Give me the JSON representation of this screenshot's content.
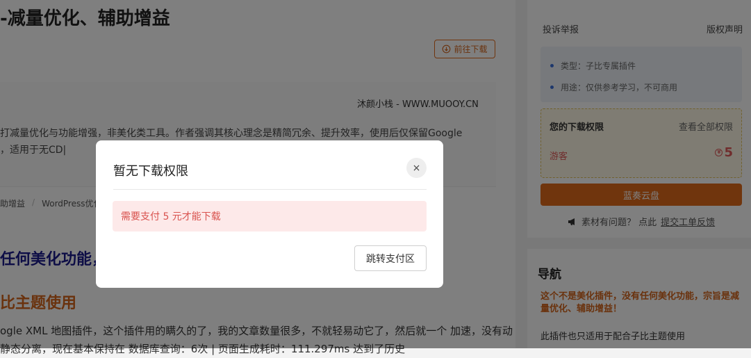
{
  "article": {
    "title": "-减量优化、辅助增益",
    "download_label": "前往下载",
    "source": "沐颜小栈 - WWW.MUOOY.CN",
    "excerpt": "打减量优化与功能增强，非美化类工具。作者强调其核心理念是精简冗余、提升效率，使用后仅保留Google ，适用于无CD|",
    "tags": [
      "助增益",
      "WordPress优化"
    ],
    "heading_blue": "任何美化功能，",
    "heading_orange": "比主题使用",
    "body": "ogle XML 地图插件，这个插件用的瞒久的了，我的文章数量很多，不就轻易动它了，然后就一个 加速，没有动静态分离，现在基本保持在 数据库查询：6次 | 页面生成耗时：111.297ms 达到了历史"
  },
  "sidebar": {
    "report": "投诉举报",
    "copyright": "版权声明",
    "info": [
      "类型：子比专属插件",
      "用途：仅供参考学习，不可商用"
    ],
    "permission": {
      "title": "您的下载权限",
      "view_all": "查看全部权限",
      "role": "游客",
      "price": "5"
    },
    "cloud_button": "蓝奏云盘",
    "feedback_prefix": "素材有问题？ 点此",
    "feedback_link": "提交工单反馈"
  },
  "nav": {
    "title": "导航",
    "highlight": "这个不是美化插件，没有任何美化功能，宗旨是减量优化、辅助增益！",
    "text": "此插件也只适用于配合子比主题使用"
  },
  "modal": {
    "title": "暂无下载权限",
    "close": "×",
    "alert": "需要支付 5 元才能下载",
    "action": "跳转支付区"
  },
  "colors": {
    "accent": "#e06a1b",
    "danger": "#d9534f",
    "nav_blue": "#1a1a8c"
  }
}
